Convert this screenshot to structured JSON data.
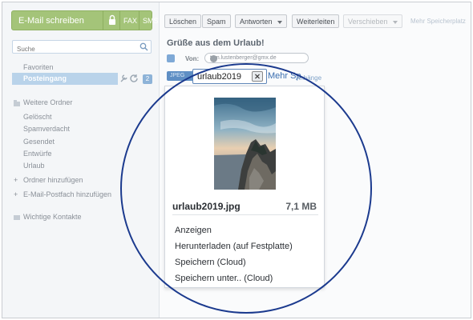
{
  "sidebar": {
    "compose_label": "E-Mail schreiben",
    "fax_label": "FAX",
    "sms_label": "SMS",
    "search_placeholder": "Suche",
    "favorites_label": "Favoriten",
    "inbox_label": "Posteingang",
    "inbox_count": "2",
    "more_folders_label": "Weitere Ordner",
    "folders": [
      "Gelöscht",
      "Spamverdacht",
      "Gesendet",
      "Entwürfe",
      "Urlaub"
    ],
    "add_folder_label": "Ordner hinzufügen",
    "add_mailbox_label": "E-Mail-Postfach hinzufügen",
    "important_contacts_label": "Wichtige Kontakte"
  },
  "toolbar": {
    "delete_label": "Löschen",
    "spam_label": "Spam",
    "reply_label": "Antworten",
    "forward_label": "Weiterleiten",
    "move_label": "Verschieben",
    "storage_label": "Mehr Speicherplatz"
  },
  "message": {
    "subject": "Grüße aus dem Urlaub!",
    "from_label": "Von:",
    "from_address": "tom.lustenberger@gmx.de",
    "attachment_badge": "JPEG",
    "attachment_chip": "urlaub2019",
    "more_label": "Mehr Sp",
    "attachments_label": "Anhänge"
  },
  "popup": {
    "file_name": "urlaub2019.jpg",
    "file_size": "7,1 MB",
    "actions": [
      "Anzeigen",
      "Herunterladen (auf Festplatte)",
      "Speichern (Cloud)",
      "Speichern unter.. (Cloud)"
    ]
  },
  "colors": {
    "compose_green": "#a4c479",
    "inbox_highlight": "#b9d3ea",
    "link_blue": "#3b6fb0",
    "circle_stroke": "#1b3a8e"
  }
}
